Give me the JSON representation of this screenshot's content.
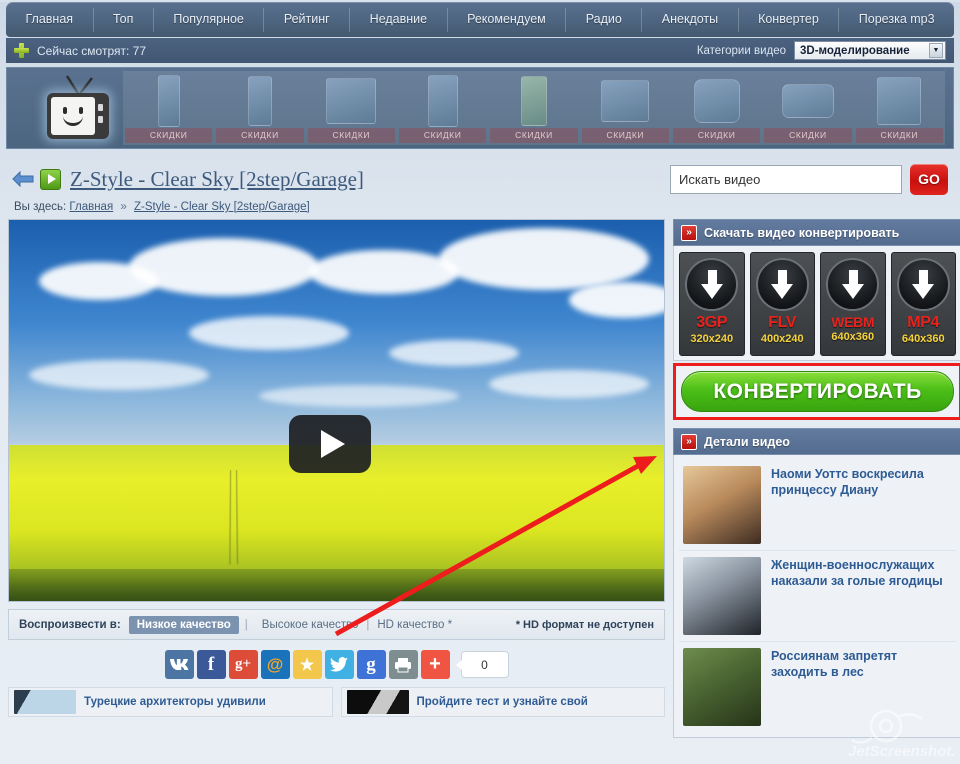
{
  "nav": {
    "items": [
      {
        "label": "Главная"
      },
      {
        "label": "Топ"
      },
      {
        "label": "Популярное"
      },
      {
        "label": "Рейтинг"
      },
      {
        "label": "Недавние"
      },
      {
        "label": "Рекомендуем"
      },
      {
        "label": "Радио"
      },
      {
        "label": "Анекдоты"
      },
      {
        "label": "Конвертер"
      },
      {
        "label": "Порезка mp3"
      }
    ]
  },
  "watchbar": {
    "plus_icon": "plus-icon",
    "viewers_label": "Сейчас смотрят: 77",
    "category_label": "Категории видео",
    "category_value": "3D-моделирование",
    "category_arrow": "▼"
  },
  "banner": {
    "logo_name": "tv-smiley-logo",
    "cells": [
      {
        "label": "СКИДКИ",
        "device": "phone-slim"
      },
      {
        "label": "СКИДКИ",
        "device": "phone-touch"
      },
      {
        "label": "СКИДКИ",
        "device": "tablet"
      },
      {
        "label": "СКИДКИ",
        "device": "console-tower"
      },
      {
        "label": "СКИДКИ",
        "device": "smartphone-green"
      },
      {
        "label": "СКИДКИ",
        "device": "dock-station"
      },
      {
        "label": "СКИДКИ",
        "device": "speaker-round"
      },
      {
        "label": "СКИДКИ",
        "device": "handheld-psp"
      },
      {
        "label": "СКИДКИ",
        "device": "mp3-player"
      }
    ]
  },
  "title_row": {
    "back_icon": "back-arrow-icon",
    "play_icon": "play-icon",
    "title": "Z-Style - Clear Sky [2step/Garage]",
    "search_value": "Искать видео",
    "search_placeholder": "Искать видео",
    "go_label": "GO"
  },
  "breadcrumb": {
    "prefix": "Вы здесь:",
    "home": "Главная",
    "separator": "»",
    "current": "Z-Style - Clear Sky [2step/Garage]"
  },
  "player": {
    "play_button": "youtube-play-button"
  },
  "quality": {
    "label": "Воспроизвести в:",
    "options": [
      {
        "label": "Низкое качество",
        "active": true
      },
      {
        "label": "Высокое качество",
        "active": false
      },
      {
        "label": "HD качество *",
        "active": false
      }
    ],
    "note": "* HD формат не доступен",
    "sep": "|"
  },
  "social": {
    "buttons": [
      {
        "name": "vk-share-icon",
        "glyph": "vk",
        "color": "#4c75a3"
      },
      {
        "name": "facebook-share-icon",
        "glyph": "f",
        "color": "#3b5998"
      },
      {
        "name": "google-plus-share-icon",
        "glyph": "g+",
        "color": "#dd4b39"
      },
      {
        "name": "mailru-share-icon",
        "glyph": "@",
        "color": "#1a72ba"
      },
      {
        "name": "favorites-star-icon",
        "glyph": "★",
        "color": "#f4c councils"
      },
      {
        "name": "twitter-share-icon",
        "glyph": "t",
        "color": "#41b0e3"
      },
      {
        "name": "google-share-icon",
        "glyph": "g",
        "color": "#3f72d6"
      },
      {
        "name": "print-icon",
        "glyph": "print",
        "color": "#7e8d90"
      },
      {
        "name": "more-share-icon",
        "glyph": "+",
        "color": "#ef5542"
      }
    ],
    "count": "0"
  },
  "bottom_news": [
    {
      "title": "Турецкие архитекторы удивили"
    },
    {
      "title": "Пройдите тест и узнайте свой"
    }
  ],
  "download_panel": {
    "header": "Скачать видео конвертировать",
    "header_badge": "»",
    "buttons": [
      {
        "format": "3GP",
        "resolution": "320x240",
        "icon": "download-arrow-icon"
      },
      {
        "format": "FLV",
        "resolution": "400x240",
        "icon": "download-arrow-icon"
      },
      {
        "format": "WEBM",
        "resolution": "640x360",
        "icon": "download-arrow-icon"
      },
      {
        "format": "MP4",
        "resolution": "640x360",
        "icon": "download-arrow-icon"
      }
    ],
    "convert_label": "КОНВЕРТИРОВАТЬ"
  },
  "details_panel": {
    "header": "Детали видео",
    "header_badge": "»",
    "items": [
      {
        "title": "Наоми Уоттс воскресила принцессу Диану",
        "thumb": "portrait-blonde-woman"
      },
      {
        "title": "Женщин-военнослужащих наказали за голые ягодицы",
        "thumb": "portrait-woman-uniform"
      },
      {
        "title": "Россиянам запретят заходить в лес",
        "thumb": "portrait-man-forest"
      }
    ]
  },
  "annotation": {
    "arrow_name": "red-pointer-arrow",
    "arrow_color": "#ee1d1d"
  },
  "watermark": {
    "text": "JetScreenshot.com"
  },
  "colors": {
    "nav_bg": "#4e6681",
    "panel_head": "#5a7196",
    "accent_red": "#ee1d1d",
    "convert_green": "#4cbf18",
    "link_blue": "#2e5b93"
  }
}
